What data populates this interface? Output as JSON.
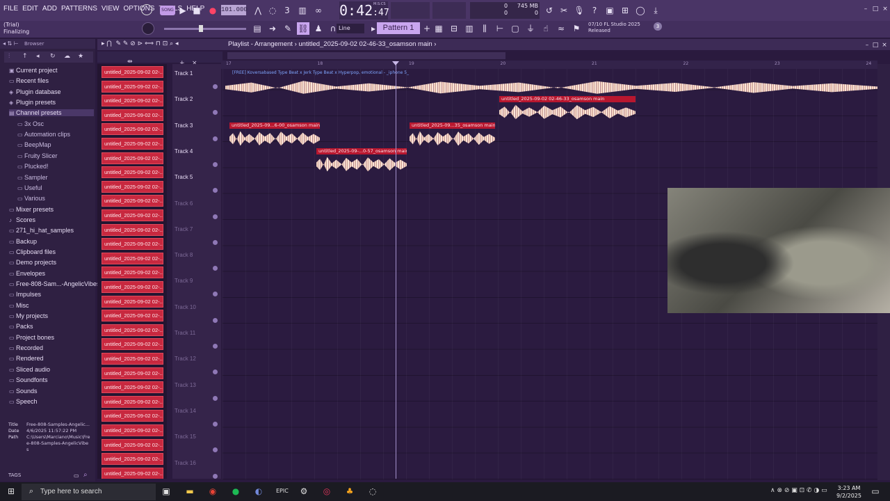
{
  "menu": [
    "FILE",
    "EDIT",
    "ADD",
    "PATTERNS",
    "VIEW",
    "OPTIONS",
    "TOOLS",
    "HELP"
  ],
  "transport": {
    "song_label": "SONG",
    "tempo": "101.000",
    "time_main": "0:42",
    "time_sub": "47",
    "msc_label": "M:S:CS"
  },
  "stats": {
    "cpu_lines": [
      "0",
      "0"
    ],
    "memory": "745 MB",
    "memory_sub": "0"
  },
  "status": {
    "trial": "(Trial)",
    "state": "Finalizing"
  },
  "toolbar2": {
    "snap": "Line",
    "pattern": "Pattern 1"
  },
  "news": {
    "line1": "07/10  FL Studio 2025",
    "line2": "Released",
    "badge": "3"
  },
  "browser": {
    "title": "Browser",
    "items": [
      {
        "label": "Current project",
        "icon": "project-icon",
        "sub": false,
        "hl": false
      },
      {
        "label": "Recent files",
        "icon": "folder-icon",
        "sub": false,
        "hl": false
      },
      {
        "label": "Plugin database",
        "icon": "plugin-icon",
        "sub": false,
        "hl": false
      },
      {
        "label": "Plugin presets",
        "icon": "plugin-icon",
        "sub": false,
        "hl": false
      },
      {
        "label": "Channel presets",
        "icon": "folder-open-icon",
        "sub": false,
        "hl": true
      },
      {
        "label": "3x Osc",
        "icon": "folder-icon",
        "sub": true,
        "hl": false
      },
      {
        "label": "Automation clips",
        "icon": "folder-icon",
        "sub": true,
        "hl": false
      },
      {
        "label": "BeepMap",
        "icon": "folder-icon",
        "sub": true,
        "hl": false
      },
      {
        "label": "Fruity Slicer",
        "icon": "folder-icon",
        "sub": true,
        "hl": false
      },
      {
        "label": "Plucked!",
        "icon": "folder-icon",
        "sub": true,
        "hl": false
      },
      {
        "label": "Sampler",
        "icon": "folder-icon",
        "sub": true,
        "hl": false
      },
      {
        "label": "Useful",
        "icon": "folder-icon",
        "sub": true,
        "hl": false
      },
      {
        "label": "Various",
        "icon": "folder-icon",
        "sub": true,
        "hl": false
      },
      {
        "label": "Mixer presets",
        "icon": "folder-icon",
        "sub": false,
        "hl": false
      },
      {
        "label": "Scores",
        "icon": "note-icon",
        "sub": false,
        "hl": false
      },
      {
        "label": "271_hi_hat_samples",
        "icon": "folder-icon",
        "sub": false,
        "hl": false
      },
      {
        "label": "Backup",
        "icon": "folder-icon",
        "sub": false,
        "hl": false
      },
      {
        "label": "Clipboard files",
        "icon": "folder-icon",
        "sub": false,
        "hl": false
      },
      {
        "label": "Demo projects",
        "icon": "folder-icon",
        "sub": false,
        "hl": false
      },
      {
        "label": "Envelopes",
        "icon": "folder-icon",
        "sub": false,
        "hl": false
      },
      {
        "label": "Free-808-Sam...-AngelicVibes",
        "icon": "folder-icon",
        "sub": false,
        "hl": false
      },
      {
        "label": "Impulses",
        "icon": "folder-icon",
        "sub": false,
        "hl": false
      },
      {
        "label": "Misc",
        "icon": "folder-icon",
        "sub": false,
        "hl": false
      },
      {
        "label": "My projects",
        "icon": "folder-icon",
        "sub": false,
        "hl": false
      },
      {
        "label": "Packs",
        "icon": "folder-icon",
        "sub": false,
        "hl": false
      },
      {
        "label": "Project bones",
        "icon": "folder-icon",
        "sub": false,
        "hl": false
      },
      {
        "label": "Recorded",
        "icon": "folder-icon",
        "sub": false,
        "hl": false
      },
      {
        "label": "Rendered",
        "icon": "folder-icon",
        "sub": false,
        "hl": false
      },
      {
        "label": "Sliced audio",
        "icon": "folder-icon",
        "sub": false,
        "hl": false
      },
      {
        "label": "Soundfonts",
        "icon": "folder-icon",
        "sub": false,
        "hl": false
      },
      {
        "label": "Sounds",
        "icon": "folder-icon",
        "sub": false,
        "hl": false
      },
      {
        "label": "Speech",
        "icon": "folder-icon",
        "sub": false,
        "hl": false
      }
    ],
    "info": {
      "title_key": "Title",
      "title_val": "Free-808-Samples-Angelic...",
      "date_key": "Date",
      "date_val": "4/6/2025 11:57:22 PM",
      "path_key": "Path",
      "path_val": "C:\\Users\\Marciano\\Music\\Free-808-Samples-AngelicVibes"
    },
    "tags_label": "TAGS"
  },
  "channels": [
    "untitled_2025-09-02 02-...",
    "untitled_2025-09-02 02-...",
    "untitled_2025-09-02 02-...",
    "untitled_2025-09-02 02-...",
    "untitled_2025-09-02 02-...",
    "untitled_2025-09-02 02-...",
    "untitled_2025-09-02 02-...",
    "untitled_2025-09-02 02-...",
    "untitled_2025-09-02 02-...",
    "untitled_2025-09-02 02-...",
    "untitled_2025-09-02 02-...",
    "untitled_2025-09-02 02-...",
    "untitled_2025-09-02 02-...",
    "untitled_2025-09-02 02-...",
    "untitled_2025-09-02 02-...",
    "untitled_2025-09-02 02-...",
    "untitled_2025-09-02 02-...",
    "untitled_2025-09-02 02-...",
    "untitled_2025-09-02 02-...",
    "untitled_2025-09-02 02-...",
    "untitled_2025-09-02 02-...",
    "untitled_2025-09-02 02-...",
    "untitled_2025-09-02 02-...",
    "untitled_2025-09-02 02-...",
    "untitled_2025-09-02 02-...",
    "untitled_2025-09-02 02-...",
    "untitled_2025-09-02 02-...",
    "untitled_2025-09-02 02-...",
    "untitled_2025-09-02 02-..."
  ],
  "playlist": {
    "title": "Playlist - Arrangement",
    "project": "untitled_2025-09-02 02-46-33_osamson main",
    "ruler": [
      "17",
      "18",
      "19",
      "20",
      "21",
      "22",
      "23",
      "24"
    ],
    "tracks": [
      "Track 1",
      "Track 2",
      "Track 3",
      "Track 4",
      "Track 5",
      "Track 6",
      "Track 7",
      "Track 8",
      "Track 9",
      "Track 10",
      "Track 11",
      "Track 12",
      "Track 13",
      "Track 14",
      "Track 15",
      "Track 16"
    ],
    "track1_clip": "[FREE] Koversabased Type Beat x Jerk Type Beat x Hyperpop, emotional - _iphone 5_",
    "clip_track2": "untitled_2025-09-02 02-46-33_osamson main",
    "clip_track3a": "untitled_2025-09...6-00_osamson main",
    "clip_track3b": "untitled_2025-09...35_osamson main",
    "clip_track4": "untitled_2025-09-...0-57_osamson main"
  },
  "taskbar": {
    "search_placeholder": "Type here to search",
    "time": "3:23 AM",
    "date": "9/2/2025"
  }
}
